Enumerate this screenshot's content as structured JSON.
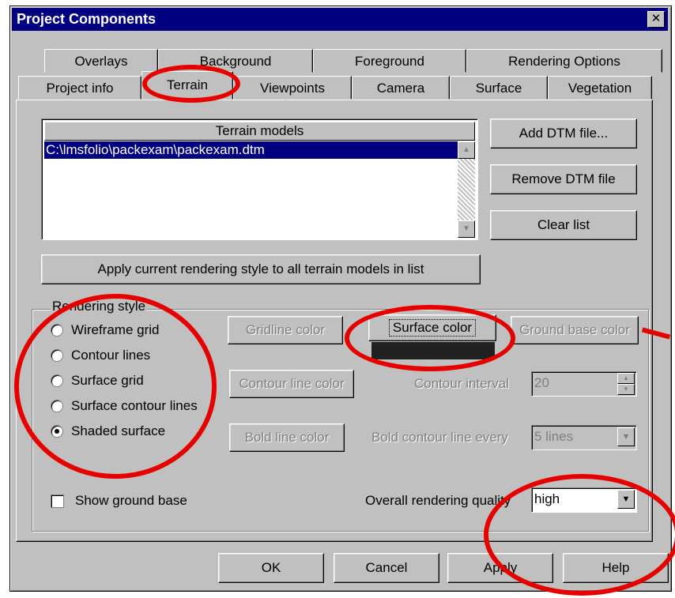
{
  "window": {
    "title": "Project Components",
    "close_label": "✕"
  },
  "tabs_row1": [
    "Overlays",
    "Background",
    "Foreground",
    "Rendering Options"
  ],
  "tabs_row2": [
    "Project info",
    "Terrain",
    "Viewpoints",
    "Camera",
    "Surface",
    "Vegetation"
  ],
  "terrain": {
    "list_header": "Terrain models",
    "selected_item": "C:\\lmsfolio\\packexam\\packexam.dtm",
    "add_button": "Add DTM file...",
    "remove_button": "Remove DTM  file",
    "clear_button": "Clear list",
    "apply_all_button": "Apply current rendering style to all terrain models in list"
  },
  "rendering_style": {
    "label": "Rendering style",
    "options": [
      "Wireframe grid",
      "Contour lines",
      "Surface grid",
      "Surface contour lines",
      "Shaded surface"
    ],
    "selected": "Shaded surface"
  },
  "colors": {
    "gridline_button": "Gridline color",
    "surface_button": "Surface color",
    "ground_base_button": "Ground base color",
    "contour_line_button": "Contour line color",
    "bold_line_button": "Bold line color",
    "surface_swatch": "#202020"
  },
  "contour": {
    "interval_label": "Contour interval",
    "interval_value": "20",
    "bold_every_label": "Bold contour line every",
    "bold_every_value": "5 lines"
  },
  "ground_base": {
    "label": "Show ground base",
    "checked": false
  },
  "quality": {
    "label": "Overall rendering quality",
    "value": "high"
  },
  "footer": {
    "ok": "OK",
    "cancel": "Cancel",
    "apply": "Apply",
    "help": "Help"
  },
  "annotation_color": "#e60000"
}
